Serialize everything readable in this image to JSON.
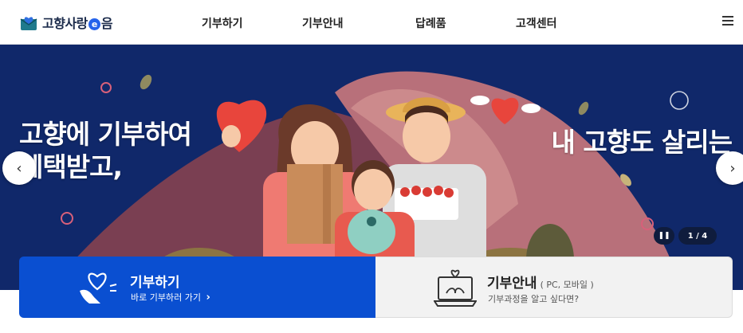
{
  "header": {
    "logo_text_1": "고향사랑",
    "logo_e": "e",
    "logo_text_2": "음",
    "nav": [
      "기부하기",
      "기부안내",
      "답례품",
      "고객센터"
    ]
  },
  "banner": {
    "headline_left_1": "고향에 기부하여",
    "headline_left_2": "혜택받고,",
    "headline_right": "내 고향도 살리는",
    "prev_icon": "‹",
    "next_icon": "›",
    "pause_icon": "❚❚",
    "counter": "1 / 4"
  },
  "cards": {
    "donate_title": "기부하기",
    "donate_sub": "바로 기부하러 가기",
    "donate_chevron": "›",
    "guide_title": "기부안내",
    "guide_note": "( PC, 모바일 )",
    "guide_sub": "기부과정을 알고 싶다면?"
  },
  "colors": {
    "banner_bg": "#10286a",
    "donate_card": "#0a4fd1",
    "guide_card": "#f2f2f2",
    "heart": "#e8453c"
  }
}
